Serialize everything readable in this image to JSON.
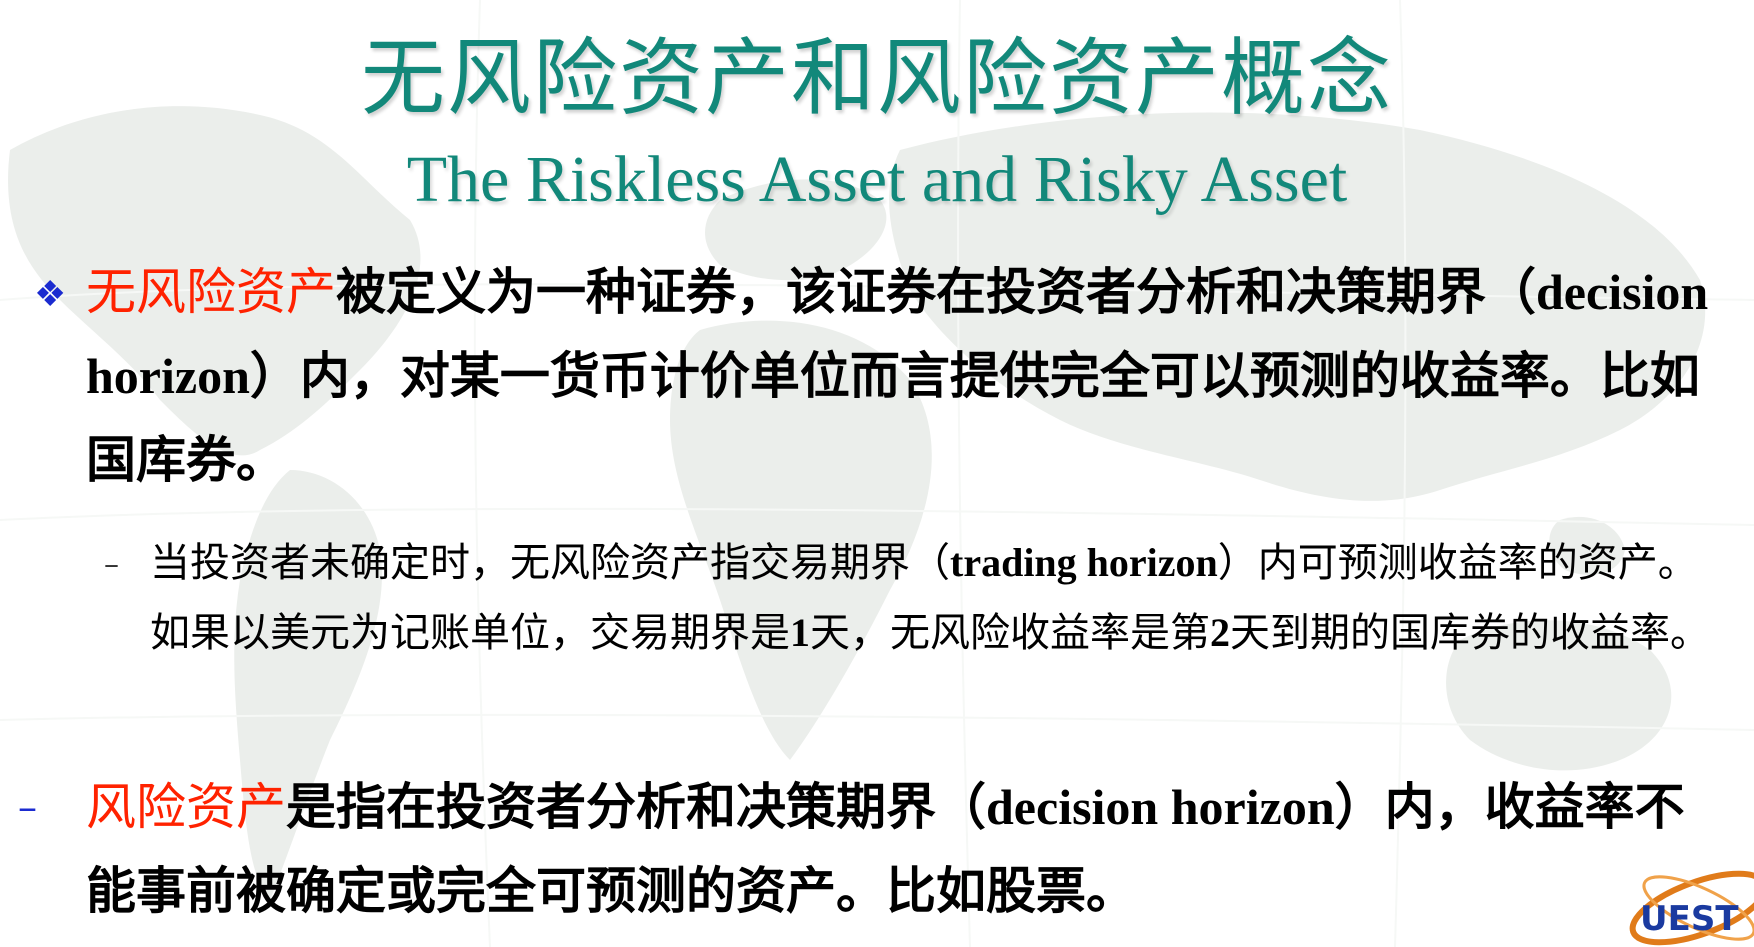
{
  "slide": {
    "title_zh": "无风险资产和风险资产概念",
    "title_en": "The Riskless Asset and Risky Asset",
    "bullet1": {
      "highlight": "无风险资产",
      "text_a": "被定义为一种证券，该证券在投资者分析和决策期界（",
      "english": "decision horizon",
      "text_b": "）内，对某一货币计价单位而言提供完全可以预测的收益率。比如国库券。"
    },
    "subbullet": {
      "text_a": "当投资者未确定时，无风险资产指交易期界（",
      "english": "trading horizon",
      "text_b": "）内可预测收益率的资产。如果以美元为记账单位，交易期界是",
      "num1": "1",
      "text_c": "天，无风险收益率是第",
      "num2": "2",
      "text_d": "天到期的国库券的收益率。"
    },
    "bullet2": {
      "highlight": "风险资产",
      "text_a": "是指在投资者分析和决策期界（",
      "english": "decision horizon",
      "text_b": "）内，收益率不能事前被确定或完全可预测的资产。比如股票。"
    },
    "markers": {
      "diamond": "❖",
      "dash": "–"
    },
    "logo_text": "UEST",
    "colors": {
      "title": "#12887a",
      "highlight": "#ff2200",
      "marker": "#1b2bd0",
      "map": "#e8ebe8"
    }
  }
}
